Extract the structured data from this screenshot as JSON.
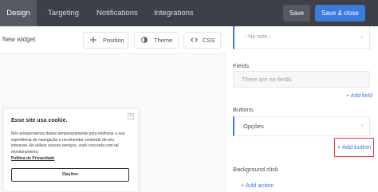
{
  "tabs": [
    {
      "label": "Design",
      "active": true
    },
    {
      "label": "Targeting",
      "active": false
    },
    {
      "label": "Notifications",
      "active": false
    },
    {
      "label": "Integrations",
      "active": false
    }
  ],
  "toolbar": {
    "save_label": "Save",
    "save_close_label": "Save & close"
  },
  "widget": {
    "name": "New widget",
    "tools": [
      {
        "label": "Position",
        "icon": "move-icon"
      },
      {
        "label": "Theme",
        "icon": "contrast-icon"
      },
      {
        "label": "CSS",
        "icon": "code-icon"
      }
    ]
  },
  "cookie": {
    "title": "Esse site usa cookie.",
    "body": "Nós armazenamos dados temporariamente para melhorar a sua experiência de navegação e recomendar conteúdo de seu interesse. Ao utilizar nossos serviços, você concorda com tal monitoramento.",
    "link": "Política de Privacidade",
    "button": "Opções",
    "close_glyph": "×"
  },
  "panel": {
    "note_placeholder": "‹ No note ›",
    "fields_label": "Fields",
    "fields_empty": "There are no fields",
    "add_field": "+ Add field",
    "buttons_label": "Buttons",
    "button_item": "Opções",
    "add_button": "+ Add button",
    "bg_click_label": "Background click",
    "add_action": "+ Add action",
    "chevron_glyph": "›"
  },
  "colors": {
    "topbar": "#3e4048",
    "accent": "#3d7bdb",
    "highlight": "#e53935"
  }
}
